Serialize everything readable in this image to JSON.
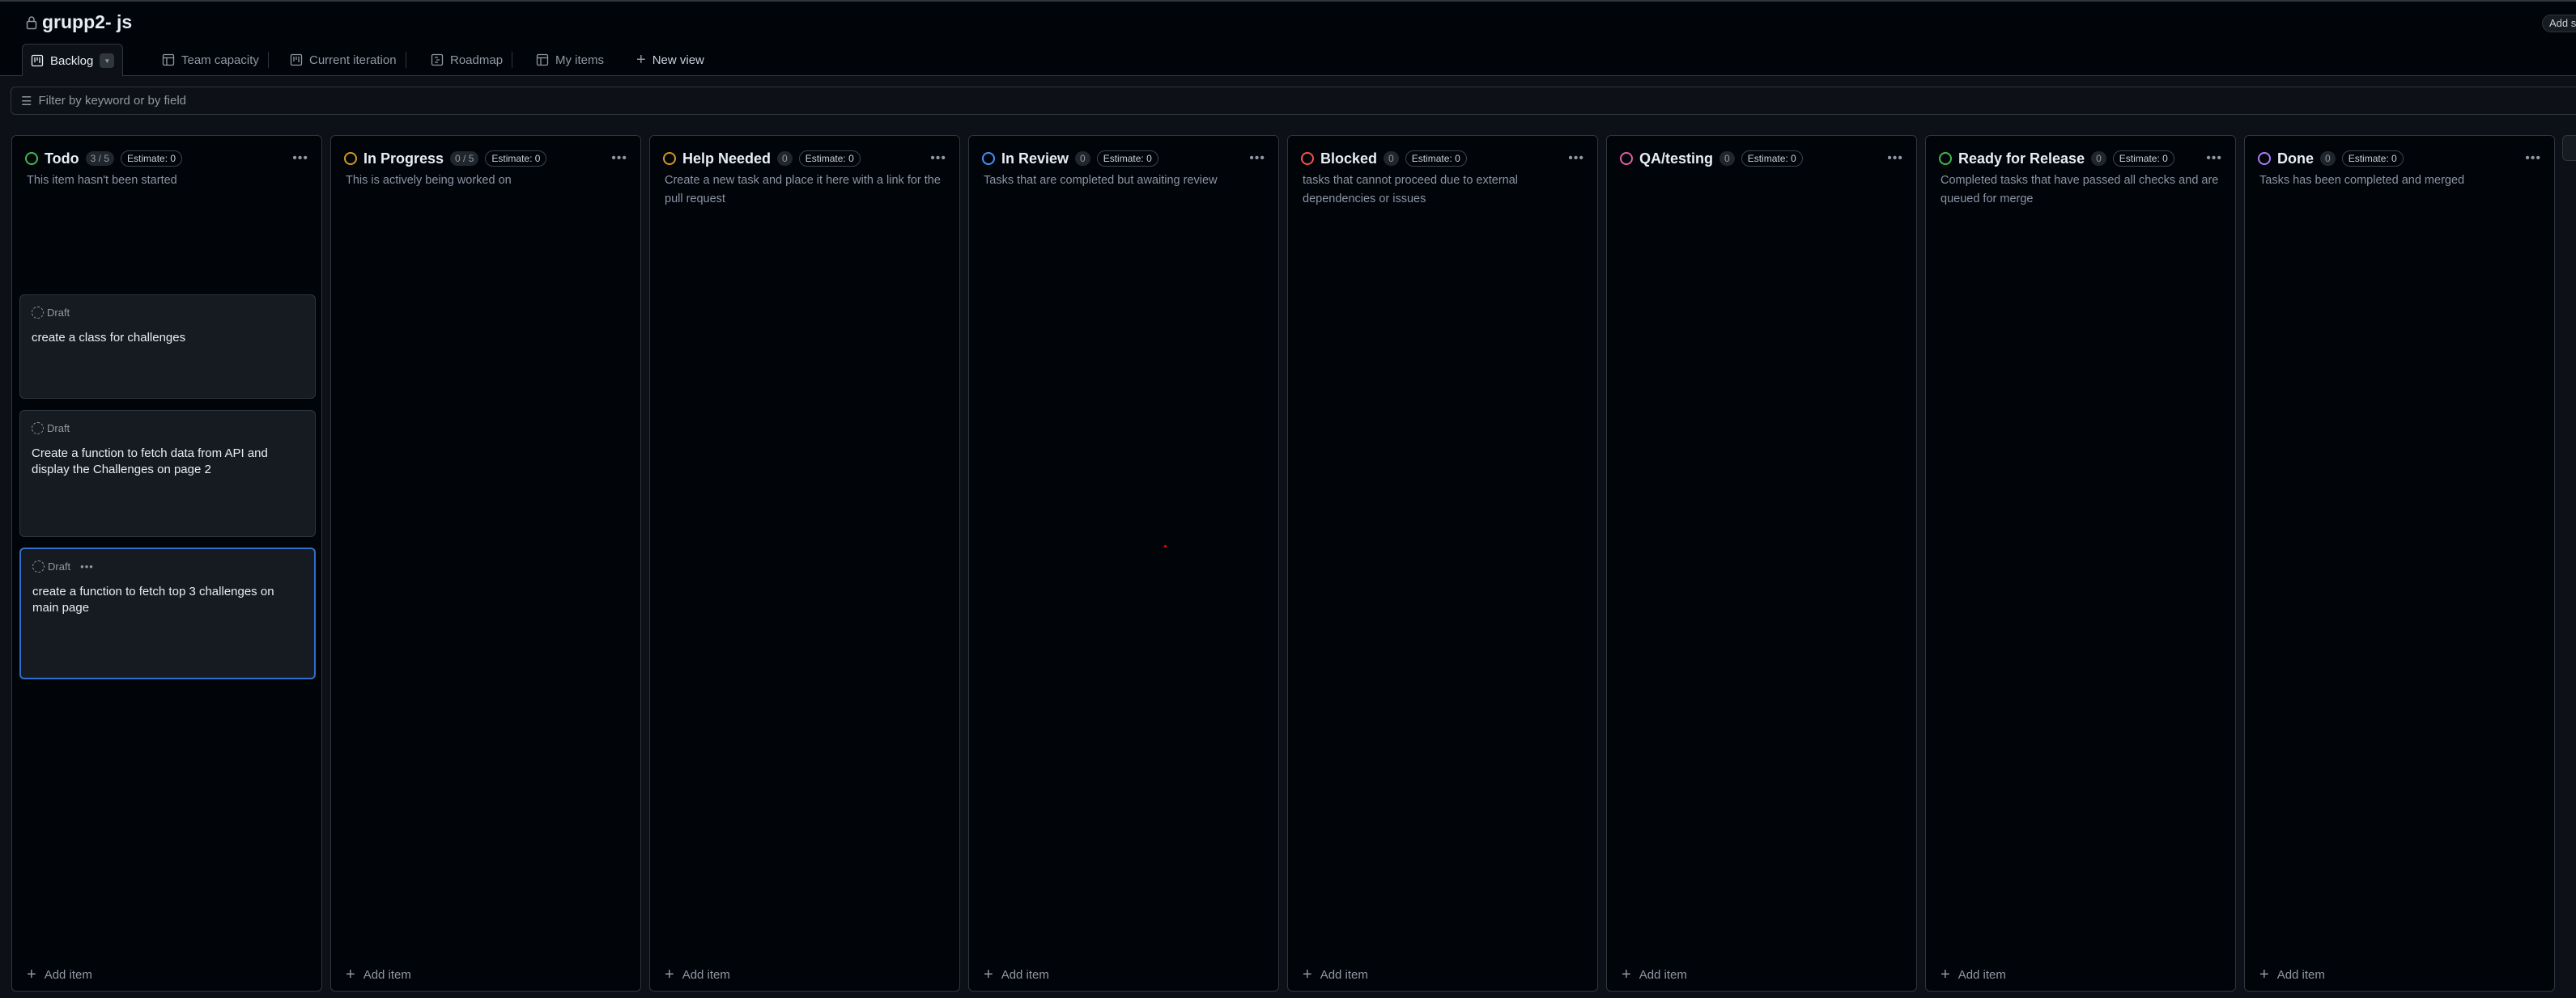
{
  "project": {
    "title": "grupp2- js",
    "add_button": "Add status update"
  },
  "tabs": [
    {
      "label": "Backlog",
      "icon": "board-icon"
    },
    {
      "label": "Team capacity",
      "icon": "table-icon"
    },
    {
      "label": "Current iteration",
      "icon": "board-icon"
    },
    {
      "label": "Roadmap",
      "icon": "roadmap-icon"
    },
    {
      "label": "My items",
      "icon": "table-icon"
    }
  ],
  "new_view": "New view",
  "filter": {
    "placeholder": "Filter by keyword or by field"
  },
  "add_item": "Add item",
  "columns": [
    {
      "name": "Todo",
      "count": "3 / 5",
      "estimate": "Estimate: 0",
      "color": "#3fb950",
      "desc": "This item hasn't been started",
      "cards": [
        {
          "status": "Draft",
          "title": "create a class for challenges"
        },
        {
          "status": "Draft",
          "title": "Create a function to fetch data from API and display the Challenges on page 2"
        },
        {
          "status": "Draft",
          "title": "create a function to fetch top 3 challenges on main page",
          "selected": true
        }
      ]
    },
    {
      "name": "In Progress",
      "count": "0 / 5",
      "estimate": "Estimate: 0",
      "color": "#d29922",
      "desc": "This is actively being worked on",
      "cards": []
    },
    {
      "name": "Help Needed",
      "count": "0",
      "estimate": "Estimate: 0",
      "color": "#d29922",
      "desc": "Create a new task and place it here with a link for the pull request",
      "cards": []
    },
    {
      "name": "In Review",
      "count": "0",
      "estimate": "Estimate: 0",
      "color": "#4493f8",
      "desc": "Tasks that are completed but awaiting review",
      "cards": []
    },
    {
      "name": "Blocked",
      "count": "0",
      "estimate": "Estimate: 0",
      "color": "#f85149",
      "desc": "tasks that cannot proceed due to external dependencies or issues",
      "cards": []
    },
    {
      "name": "QA/testing",
      "count": "0",
      "estimate": "Estimate: 0",
      "color": "#db61a2",
      "desc": "",
      "cards": []
    },
    {
      "name": "Ready for Release",
      "count": "0",
      "estimate": "Estimate: 0",
      "color": "#3fb950",
      "desc": "Completed tasks that have passed all checks and are queued for merge",
      "cards": []
    },
    {
      "name": "Done",
      "count": "0",
      "estimate": "Estimate: 0",
      "color": "#ab7df8",
      "desc": "Tasks has been completed and merged",
      "cards": []
    }
  ]
}
